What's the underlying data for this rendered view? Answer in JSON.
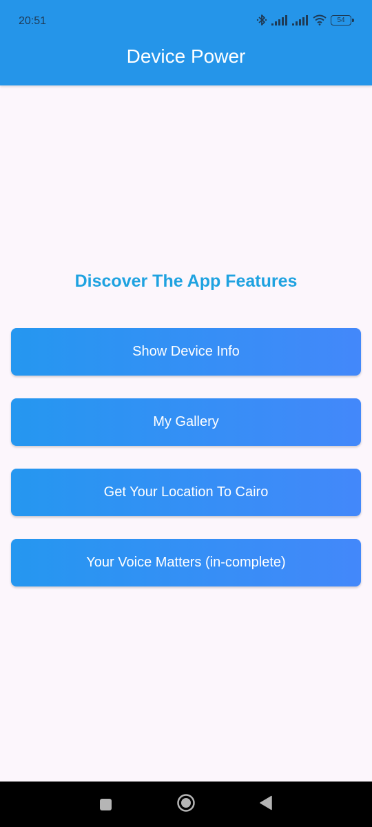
{
  "status_bar": {
    "time": "20:51",
    "battery_level": "54",
    "icons": [
      "bluetooth-icon",
      "signal-icon",
      "signal-icon",
      "wifi-icon",
      "battery-icon"
    ]
  },
  "app_bar": {
    "title": "Device Power",
    "color": "#2595e9"
  },
  "main": {
    "heading": "Discover The App Features",
    "heading_color": "#1fa2e0",
    "buttons": [
      {
        "label": "Show Device Info"
      },
      {
        "label": "My Gallery"
      },
      {
        "label": "Get Your Location To Cairo"
      },
      {
        "label": "Your Voice Matters (in-complete)"
      }
    ]
  },
  "nav_bar": {
    "items": [
      "recents-icon",
      "home-icon",
      "back-icon"
    ]
  }
}
